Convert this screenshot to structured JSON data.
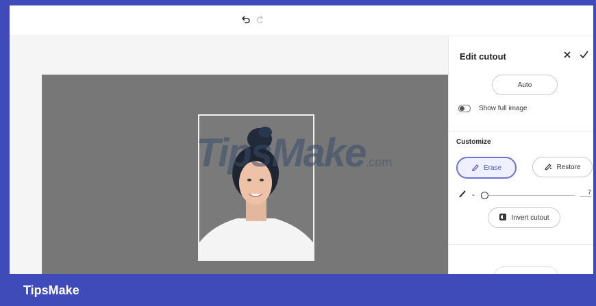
{
  "toolbar": {
    "undo_icon": "undo-icon",
    "redo_icon": "redo-icon"
  },
  "canvas": {
    "background_color": "#777777",
    "photo_subject": "portrait-photo",
    "watermark_main": "TipsMake",
    "watermark_suffix": ".com"
  },
  "panel": {
    "title": "Edit cutout",
    "close_icon": "close-icon",
    "confirm_icon": "check-icon",
    "auto_label": "Auto",
    "show_full_image_label": "Show full image",
    "show_full_image_on": false,
    "customize_title": "Customize",
    "erase_label": "Erase",
    "restore_label": "Restore",
    "brush_size_value": "7",
    "brush_size_fraction": 0.0,
    "brush_minus": "-",
    "invert_label": "Invert cutout",
    "accent_color": "#6b74d6"
  },
  "footer": {
    "brand": "TipsMake",
    "background_color": "#3f4bb8"
  }
}
